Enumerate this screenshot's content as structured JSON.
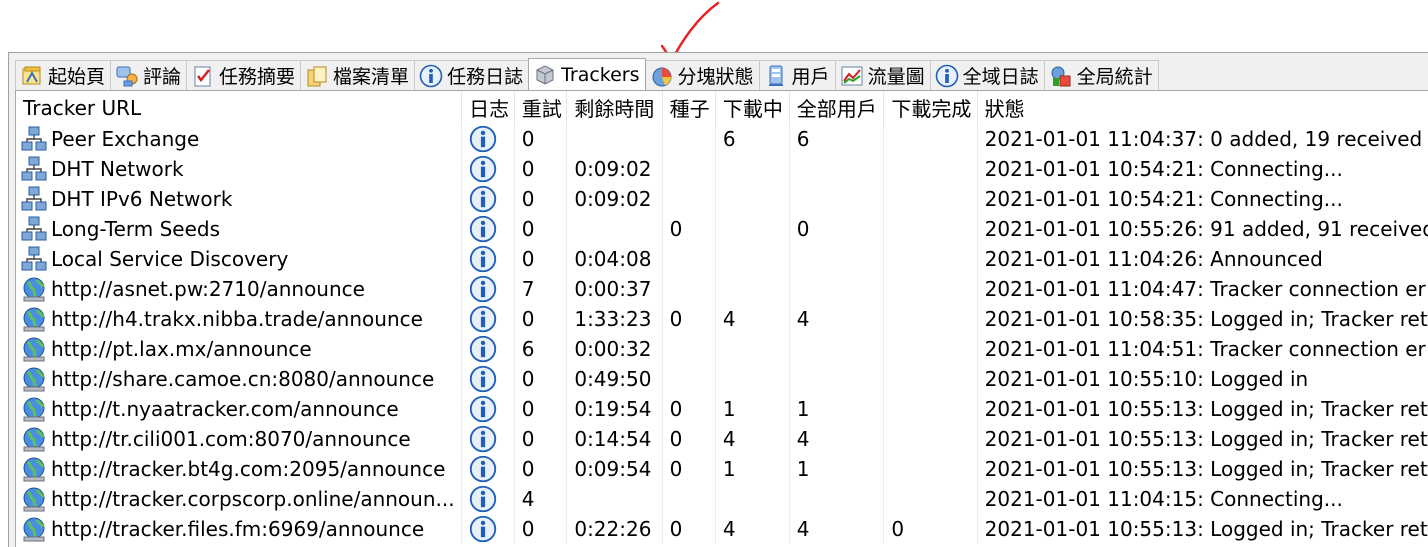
{
  "tabs": [
    {
      "label": "起始頁",
      "icon": "home-icon"
    },
    {
      "label": "評論",
      "icon": "comments-icon"
    },
    {
      "label": "任務摘要",
      "icon": "task-summary-icon"
    },
    {
      "label": "檔案清單",
      "icon": "file-list-icon"
    },
    {
      "label": "任務日誌",
      "icon": "info-icon"
    },
    {
      "label": "Trackers",
      "icon": "trackers-icon",
      "active": true
    },
    {
      "label": "分塊狀態",
      "icon": "pie-chart-icon"
    },
    {
      "label": "用戶",
      "icon": "users-icon"
    },
    {
      "label": "流量圖",
      "icon": "traffic-graph-icon"
    },
    {
      "label": "全域日誌",
      "icon": "info-icon"
    },
    {
      "label": "全局統計",
      "icon": "global-stats-icon"
    }
  ],
  "columns": [
    "Tracker URL",
    "日志",
    "重試",
    "剩餘時間",
    "種子",
    "下載中",
    "全部用戶",
    "下載完成",
    "狀態"
  ],
  "rows": [
    {
      "url": "Peer Exchange",
      "icon": "network-icon",
      "retry": "0",
      "remaining": "",
      "seeds": "",
      "downloading": "6",
      "peers": "6",
      "completed": "",
      "status": "2021-01-01 11:04:37: 0 added, 19 received"
    },
    {
      "url": "DHT Network",
      "icon": "network-icon",
      "retry": "0",
      "remaining": "0:09:02",
      "seeds": "",
      "downloading": "",
      "peers": "",
      "completed": "",
      "status": "2021-01-01 10:54:21: Connecting..."
    },
    {
      "url": "DHT IPv6 Network",
      "icon": "network-icon",
      "retry": "0",
      "remaining": "0:09:02",
      "seeds": "",
      "downloading": "",
      "peers": "",
      "completed": "",
      "status": "2021-01-01 10:54:21: Connecting..."
    },
    {
      "url": "Long-Term Seeds",
      "icon": "network-icon",
      "retry": "0",
      "remaining": "",
      "seeds": "0",
      "downloading": "",
      "peers": "0",
      "completed": "",
      "status": "2021-01-01 10:55:26: 91 added, 91 received"
    },
    {
      "url": "Local Service Discovery",
      "icon": "network-icon",
      "retry": "0",
      "remaining": "0:04:08",
      "seeds": "",
      "downloading": "",
      "peers": "",
      "completed": "",
      "status": "2021-01-01 11:04:26: Announced"
    },
    {
      "url": "http://asnet.pw:2710/announce",
      "icon": "globe-icon",
      "retry": "7",
      "remaining": "0:00:37",
      "seeds": "",
      "downloading": "",
      "peers": "",
      "completed": "",
      "status": "2021-01-01 11:04:47: Tracker connection er"
    },
    {
      "url": "http://h4.trakx.nibba.trade/announce",
      "icon": "globe-icon",
      "retry": "0",
      "remaining": "1:33:23",
      "seeds": "0",
      "downloading": "4",
      "peers": "4",
      "completed": "",
      "status": "2021-01-01 10:58:35: Logged in; Tracker ret"
    },
    {
      "url": "http://pt.lax.mx/announce",
      "icon": "globe-icon",
      "retry": "6",
      "remaining": "0:00:32",
      "seeds": "",
      "downloading": "",
      "peers": "",
      "completed": "",
      "status": "2021-01-01 11:04:51: Tracker connection er"
    },
    {
      "url": "http://share.camoe.cn:8080/announce",
      "icon": "globe-icon",
      "retry": "0",
      "remaining": "0:49:50",
      "seeds": "",
      "downloading": "",
      "peers": "",
      "completed": "",
      "status": "2021-01-01 10:55:10: Logged in"
    },
    {
      "url": "http://t.nyaatracker.com/announce",
      "icon": "globe-icon",
      "retry": "0",
      "remaining": "0:19:54",
      "seeds": "0",
      "downloading": "1",
      "peers": "1",
      "completed": "",
      "status": "2021-01-01 10:55:13: Logged in; Tracker ret"
    },
    {
      "url": "http://tr.cili001.com:8070/announce",
      "icon": "globe-icon",
      "retry": "0",
      "remaining": "0:14:54",
      "seeds": "0",
      "downloading": "4",
      "peers": "4",
      "completed": "",
      "status": "2021-01-01 10:55:13: Logged in; Tracker ret"
    },
    {
      "url": "http://tracker.bt4g.com:2095/announce",
      "icon": "globe-icon",
      "retry": "0",
      "remaining": "0:09:54",
      "seeds": "0",
      "downloading": "1",
      "peers": "1",
      "completed": "",
      "status": "2021-01-01 10:55:13: Logged in; Tracker ret"
    },
    {
      "url": "http://tracker.corpscorp.online/announ...",
      "icon": "globe-icon",
      "retry": "4",
      "remaining": "",
      "seeds": "",
      "downloading": "",
      "peers": "",
      "completed": "",
      "status": "2021-01-01 11:04:15: Connecting..."
    },
    {
      "url": "http://tracker.files.fm:6969/announce",
      "icon": "globe-icon",
      "retry": "0",
      "remaining": "0:22:26",
      "seeds": "0",
      "downloading": "4",
      "peers": "4",
      "completed": "0",
      "status": "2021-01-01 10:55:13: Logged in; Tracker ret"
    }
  ],
  "colors": {
    "annotation": "#e8201e",
    "info_icon": "#1f5fb8"
  }
}
